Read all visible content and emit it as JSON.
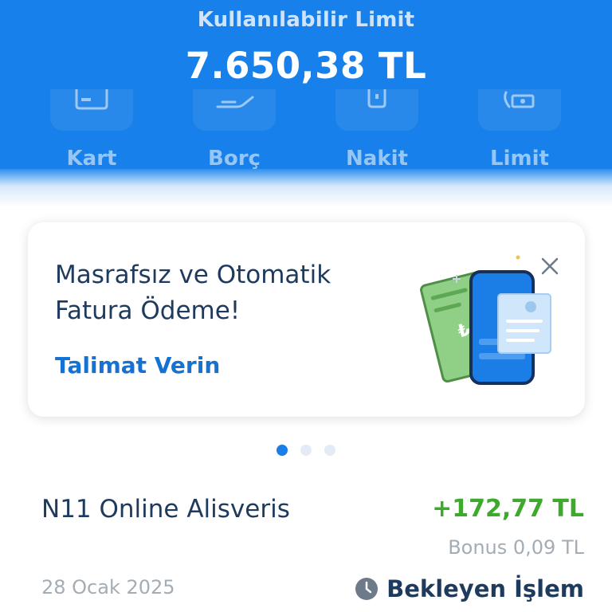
{
  "header": {
    "limit_label": "Kullanılabilir Limit",
    "limit_value": "7.650,38 TL"
  },
  "actions": [
    {
      "label": "Kart",
      "icon": "card-icon"
    },
    {
      "label": "Borç",
      "icon": "hand-icon"
    },
    {
      "label": "Nakit",
      "icon": "cash-icon"
    },
    {
      "label": "Limit",
      "icon": "limit-icon"
    }
  ],
  "promo": {
    "title_line1": "Masrafsız ve Otomatik",
    "title_line2": "Fatura Ödeme!",
    "link": "Talimat Verin"
  },
  "pager": {
    "count": 3,
    "active": 0
  },
  "transaction": {
    "name": "N11 Online Alisveris",
    "amount": "+172,77 TL",
    "bonus": "Bonus 0,09 TL",
    "date": "28 Ocak 2025",
    "status": "Bekleyen İşlem"
  },
  "colors": {
    "header_blue": "#1880ea",
    "accent_green": "#3daa2b",
    "link_blue": "#1572d3",
    "text_dark": "#1e3a5c"
  }
}
